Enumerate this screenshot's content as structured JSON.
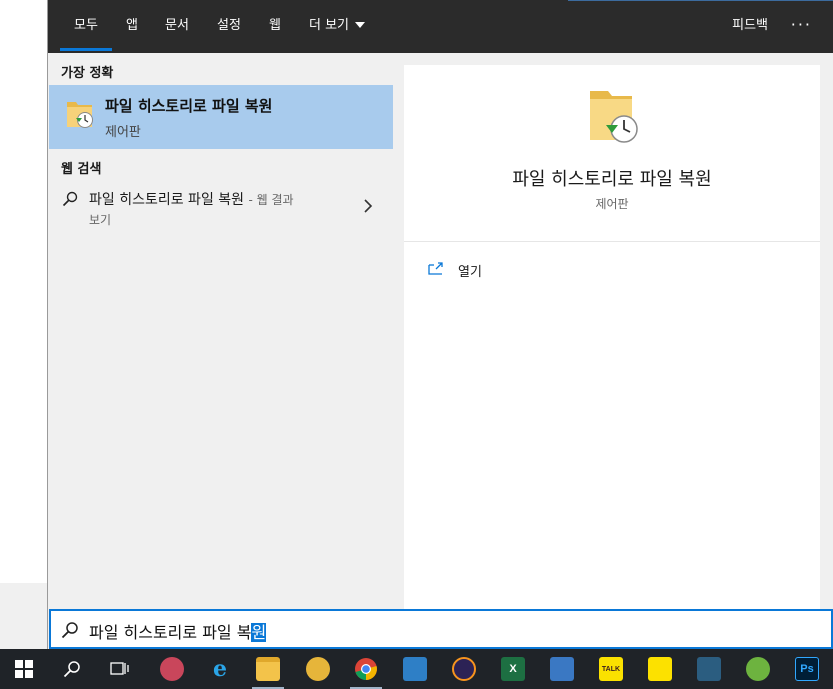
{
  "tabs": [
    {
      "label": "모두",
      "active": true
    },
    {
      "label": "앱"
    },
    {
      "label": "문서"
    },
    {
      "label": "설정"
    },
    {
      "label": "웹"
    },
    {
      "label": "더 보기"
    }
  ],
  "header": {
    "feedback_label": "피드백",
    "more_options_label": "···"
  },
  "results": {
    "best_match_heading": "가장 정확",
    "best_match": {
      "title": "파일 히스토리로 파일 복원",
      "subtitle": "제어판",
      "icon": "folder-history-icon"
    },
    "web_heading": "웹 검색",
    "web_result": {
      "query": "파일 히스토리로 파일 복원",
      "suffix": "- 웹 결과",
      "suffix_line2": "보기"
    }
  },
  "preview": {
    "title": "파일 히스토리로 파일 복원",
    "subtitle": "제어판",
    "actions": [
      {
        "label": "열기",
        "icon": "open-icon"
      }
    ]
  },
  "search": {
    "text_before": "파일 히스토리로 파일 복",
    "text_selected": "원"
  },
  "taskbar": {
    "items": [
      {
        "name": "start-icon"
      },
      {
        "name": "search-icon"
      },
      {
        "name": "task-view-icon"
      },
      {
        "name": "paint-app-icon"
      },
      {
        "name": "internet-explorer-icon"
      },
      {
        "name": "file-explorer-icon",
        "running": true
      },
      {
        "name": "everything-search-icon"
      },
      {
        "name": "chrome-icon",
        "running": true
      },
      {
        "name": "hwp-icon"
      },
      {
        "name": "eclipse-icon"
      },
      {
        "name": "excel-icon",
        "label": "X"
      },
      {
        "name": "remote-desktop-icon"
      },
      {
        "name": "kakaotalk-icon",
        "label": "TALK"
      },
      {
        "name": "sticky-notes-icon"
      },
      {
        "name": "mysql-workbench-icon"
      },
      {
        "name": "spring-tool-icon"
      },
      {
        "name": "photoshop-icon",
        "label": "Ps"
      }
    ]
  },
  "colors": {
    "accent": "#0a78d7",
    "topbar": "#2b2b2b",
    "selection_bg": "#a8cbed",
    "taskbar": "#1f2328"
  }
}
